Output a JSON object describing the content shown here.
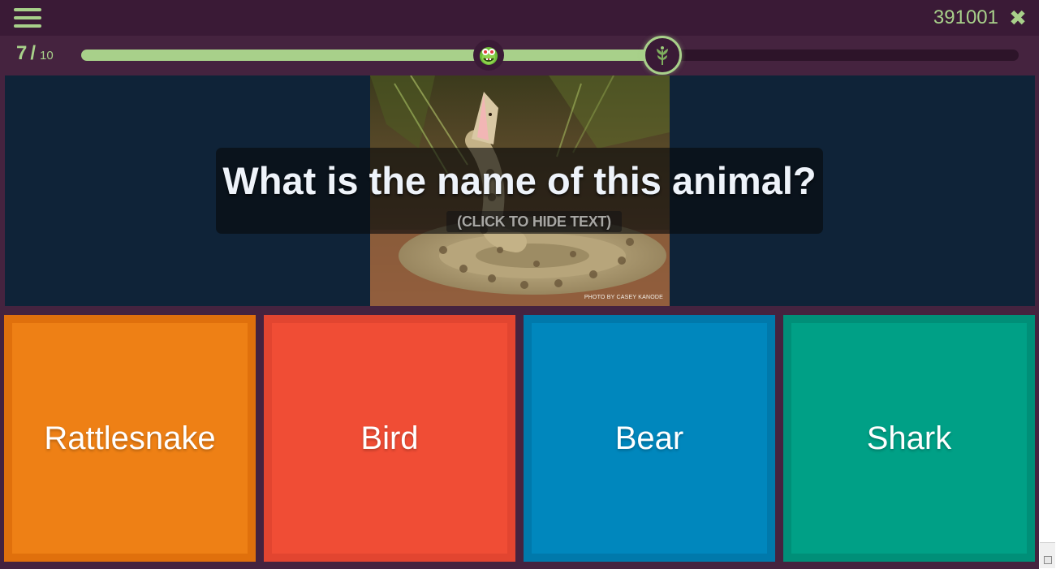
{
  "header": {
    "menu_icon": "hamburger-menu-icon",
    "game_code": "391001",
    "close_icon": "close-x-icon",
    "close_glyph": "✖"
  },
  "progress": {
    "current": "7",
    "separator": "/",
    "total": "10",
    "player_position_fraction": 0.435,
    "goal_position_fraction": 0.62,
    "player_avatar_icon": "monster-avatar-icon",
    "goal_icon": "plant-leaf-icon"
  },
  "question": {
    "text": "What is the name of this animal?",
    "hide_hint": "(CLICK TO HIDE TEXT)",
    "photo_credit": "PHOTO BY CASEY KANODE"
  },
  "answers": [
    {
      "label": "Rattlesnake",
      "color": "#ee7d10",
      "inner_color": "#ee8015",
      "border_color": "#e0700c"
    },
    {
      "label": "Bird",
      "color": "#f04d35",
      "inner_color": "#f04d35",
      "border_color": "#e24530"
    },
    {
      "label": "Bear",
      "color": "#0087bd",
      "inner_color": "#0087bd",
      "border_color": "#0079ab"
    },
    {
      "label": "Shark",
      "color": "#009e86",
      "inner_color": "#00a086",
      "border_color": "#008f78"
    }
  ],
  "colors": {
    "accent": "#a8d08a",
    "background": "#45233f",
    "topbar": "#3a1a36",
    "question_panel": "#0f2338"
  }
}
